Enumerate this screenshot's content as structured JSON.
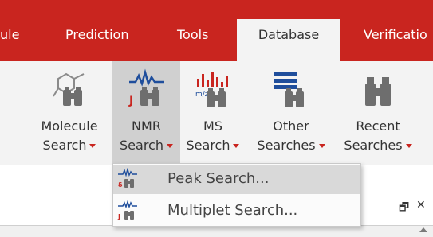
{
  "tabs": [
    {
      "label": "ule"
    },
    {
      "label": "Prediction"
    },
    {
      "label": "Tools"
    },
    {
      "label": "Database",
      "active": true
    },
    {
      "label": "Verificatio"
    }
  ],
  "ribbon": {
    "buttons": [
      {
        "line1": "Molecule",
        "line2": "Search",
        "icon": "molecule-binoculars-icon"
      },
      {
        "line1": "NMR",
        "line2": "Search",
        "icon": "nmr-binoculars-icon",
        "pressed": true
      },
      {
        "line1": "MS",
        "line2": "Search",
        "icon": "ms-binoculars-icon"
      },
      {
        "line1": "Other",
        "line2": "Searches",
        "icon": "list-binoculars-icon"
      },
      {
        "line1": "Recent",
        "line2": "Searches",
        "icon": "binoculars-icon"
      }
    ]
  },
  "dropdown": {
    "items": [
      {
        "label": "Peak Search...",
        "icon": "peak-search-icon",
        "hover": true
      },
      {
        "label": "Multiplet Search...",
        "icon": "multiplet-search-icon"
      }
    ]
  },
  "panel": {
    "float_glyph": "🗗",
    "close_glyph": "✕"
  },
  "colors": {
    "accent": "#c9251f",
    "ribbon_bg": "#f3f3f3",
    "pressed_bg": "#d0d0d0",
    "hover_bg": "#d9d9d9",
    "icon_blue": "#1f4e9c"
  }
}
